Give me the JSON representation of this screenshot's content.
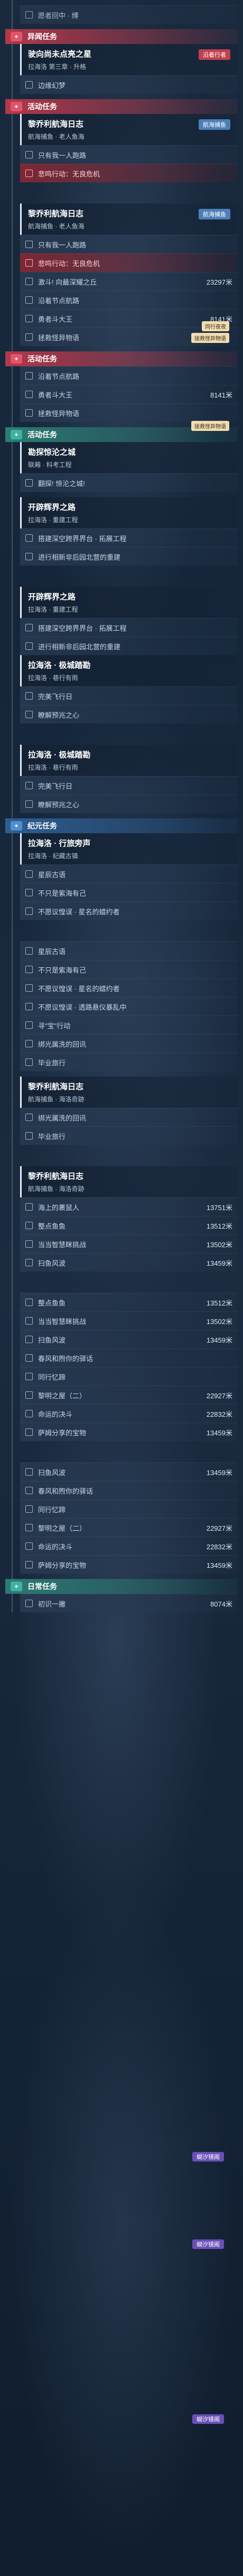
{
  "sections": {
    "s0_row": "愿者回中 · 缚",
    "cat_yiwen": "异闻任务",
    "card1_title": "驶向尚未点亮之星",
    "card1_sub": "拉海洛 第三章 · 升格",
    "card1_tag": "沿着行者",
    "row_bianjing": "边缘幻梦",
    "cat_huodong1": "活动任务",
    "card2_title": "黎乔利航海日志",
    "card2_sub": "航海捕鱼 · 老人鱼海",
    "card2_tag": "航海捕鱼",
    "row_youyizhi": "只有我一人跑路",
    "row_beiju1": "悲鸣行动：无良危机",
    "card3_title": "黎乔利航海日志",
    "card3_sub": "航海捕鱼 · 老人鱼海",
    "card3_tag": "航海捕鱼",
    "row_youyizhi2": "只有我一人跑路",
    "row_beiju2": "悲鸣行动：无良危机",
    "row_jiji": "激斗! 向最深耀之丘",
    "row_jiji_dist": "23297米",
    "row_yanzhe": "沿着节点航路",
    "row_yongzhe": "勇者斗大王",
    "row_yongzhe_dist": "8141米",
    "row_zhengjiu": "拯救怪异物语",
    "cat_huodong2": "活动任务",
    "row_yanzhe2": "沿着节点航路",
    "row_yongzhe2": "勇者斗大王",
    "row_yongzhe2_dist": "8141米",
    "row_zhengjiu2": "拯救怪异物语",
    "cat_huodong3": "活动任务",
    "card4_title": "勘探惊沦之城",
    "card4_sub": "联厢 · 科考工程",
    "row_shanquan": "翻探! 惊沦之城!",
    "card5_title": "开辟辉界之路",
    "card5_sub": "拉海洛 · 重建工程",
    "row_qiuluo": "搭建深空跨界界台 · 拓展工程",
    "row_zhixing": "进行相新非后园北营的重建",
    "card6_title": "开辟辉界之路",
    "card6_sub": "拉海洛 · 重建工程",
    "row_qiuluo2": "搭建深空跨界界台 · 拓展工程",
    "row_zhixing2": "进行相新非后园北营的重建",
    "card7_title": "拉海洛 · 极城踏勘",
    "card7_sub": "拉海洛 · 巷行有雨",
    "row_wancheng": "完美飞行日",
    "row_kuizhi": "瞭解预兆之心",
    "card8_title": "拉海洛 · 极城踏勘",
    "card8_sub": "拉海洛 · 巷行有雨",
    "row_wancheng2": "完美飞行日",
    "row_kuizhi2": "瞭解预兆之心",
    "cat_jiyuan": "纪元任务",
    "card9_title": "拉海洛 · 行旅旁声",
    "card9_sub": "拉海洛 · 纪藏古镇",
    "row_xingming": "星辰古语",
    "row_buzhi": "不只是紫海有己",
    "row_bugan": "不愿议惶误 · 星名的蜡约者",
    "row_xingming2": "星辰古语",
    "row_buzhi2": "不只是紫海有己",
    "row_bugan2": "不愿议惶误 · 星名的蜡约者",
    "row_bugan3": "不愿议惶误 · 透路悬仪暴乱中",
    "row_xunzhao": "寻\"宝\"行动",
    "row_huishu": "绑光属洗的回讯",
    "row_biye": "毕业旅行",
    "card10_title": "黎乔利航海日志",
    "card10_sub": "航海捕鱼 · 海洛奇跡",
    "row_huishu2": "绑光属洗的回讯",
    "row_biye2": "毕业旅行",
    "card11_title": "黎乔利航海日志",
    "card11_sub": "航海捕鱼 · 海洛奇跡",
    "card11_tag": "航海捕鱼",
    "row_haishang": "海上的裹鼠人",
    "row_haishang_dist": "13751米",
    "row_zhixian": "整点鱼鱼",
    "row_zhixian_dist": "13512米",
    "row_dangyou": "当当智慧眯挑战",
    "row_dangyou_dist": "13502米",
    "row_dangyou2": "扫鱼风波",
    "row_dangyou2_dist": "13459米",
    "float_jihuo": "蝴汐镜阁",
    "row_zhixian2": "整点鱼鱼",
    "row_zhixian2_dist": "13512米",
    "row_dangyou3": "当当智慧眯挑战",
    "row_dangyou3_dist": "13502米",
    "row_yufeng": "扫鱼风波",
    "row_yufeng_dist": "13459米",
    "float_jihuo2": "蝴汐镜阁",
    "row_chunfeng": "春风和煦你的驿话",
    "row_tongxing": "同行忆蹄",
    "row_liming": "黎明之屋（二）",
    "row_liming_dist": "22927米",
    "row_jingqiu": "命运的决斗",
    "row_jingqiu_dist": "22832米",
    "row_saduo": "萨姆分享的宝物",
    "row_saduo_dist": "13459米",
    "row_haifeng": "扫鱼风波",
    "row_haifeng_dist": "13459米",
    "float_jihuo3": "蝴汐镜阁",
    "row_chunfeng2": "春风和煦你的驿话",
    "row_tongxing2": "同行忆蹄",
    "row_liming2": "黎明之屋（二）",
    "row_liming2_dist": "22927米",
    "row_jingqiu2": "命运的决斗",
    "row_jingqiu2_dist": "22832米",
    "row_saduo2": "萨姆分享的宝物",
    "row_saduo2_dist": "13459米",
    "cat_richang": "日常任务",
    "row_chuyi": "初识一撇",
    "row_chuyi_dist": "8074米",
    "bubble1": "拯救怪异物语",
    "bubble2": "拯救怪异物语",
    "bubble_top1": "同行夜夜"
  },
  "colors": {
    "pink_cat": "#b2394a",
    "teal_cat": "#2c7d74",
    "blue_cat": "#2d5f93",
    "alert_row": "#c0404f"
  }
}
